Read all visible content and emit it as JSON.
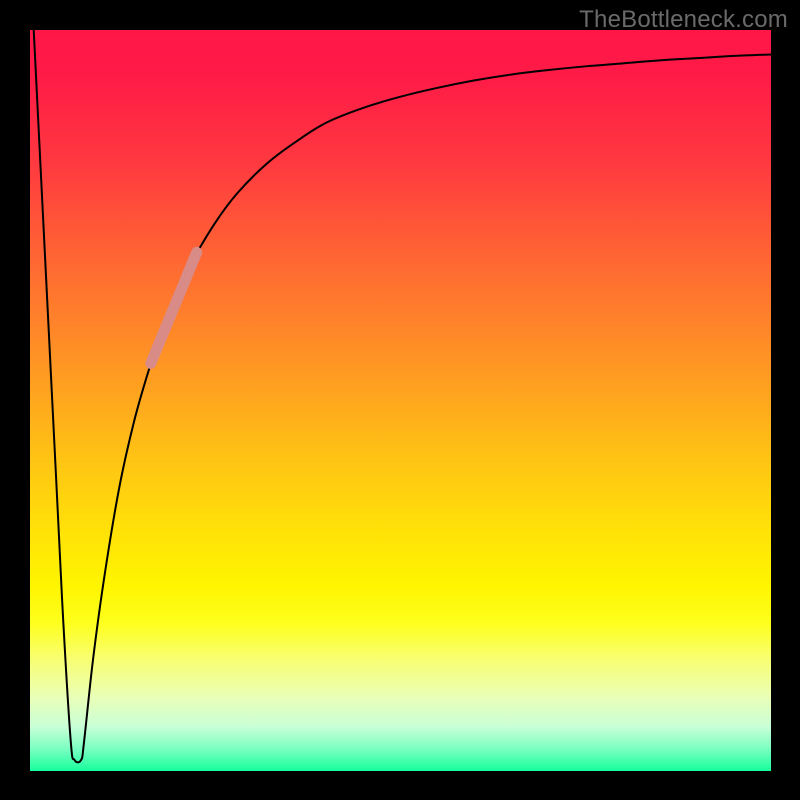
{
  "watermark": "TheBottleneck.com",
  "chart_data": {
    "type": "line",
    "title": "",
    "xlabel": "",
    "ylabel": "",
    "xlim": [
      0,
      100
    ],
    "ylim": [
      0,
      100
    ],
    "background_gradient_stops": [
      {
        "pos": 0.0,
        "color": "#ff1748"
      },
      {
        "pos": 0.06,
        "color": "#ff1a47"
      },
      {
        "pos": 0.18,
        "color": "#ff3940"
      },
      {
        "pos": 0.32,
        "color": "#ff6a32"
      },
      {
        "pos": 0.46,
        "color": "#ff9922"
      },
      {
        "pos": 0.58,
        "color": "#ffc414"
      },
      {
        "pos": 0.68,
        "color": "#ffe307"
      },
      {
        "pos": 0.75,
        "color": "#fff500"
      },
      {
        "pos": 0.8,
        "color": "#feff1d"
      },
      {
        "pos": 0.85,
        "color": "#f8ff73"
      },
      {
        "pos": 0.9,
        "color": "#eaffb7"
      },
      {
        "pos": 0.94,
        "color": "#c9ffd6"
      },
      {
        "pos": 0.97,
        "color": "#7bffc2"
      },
      {
        "pos": 1.0,
        "color": "#17ff9d"
      }
    ],
    "series": [
      {
        "name": "bottleneck-curve",
        "stroke": "#000000",
        "stroke_width": 2,
        "points": [
          {
            "x": 0.5,
            "y": 100.0
          },
          {
            "x": 1.5,
            "y": 80.0
          },
          {
            "x": 2.5,
            "y": 60.0
          },
          {
            "x": 3.5,
            "y": 40.0
          },
          {
            "x": 4.5,
            "y": 20.0
          },
          {
            "x": 5.5,
            "y": 4.0
          },
          {
            "x": 6.0,
            "y": 1.5
          },
          {
            "x": 6.9,
            "y": 1.5
          },
          {
            "x": 7.3,
            "y": 4.0
          },
          {
            "x": 8.5,
            "y": 15.0
          },
          {
            "x": 10.0,
            "y": 26.0
          },
          {
            "x": 12.0,
            "y": 38.0
          },
          {
            "x": 14.0,
            "y": 47.0
          },
          {
            "x": 16.0,
            "y": 54.0
          },
          {
            "x": 18.0,
            "y": 60.0
          },
          {
            "x": 20.0,
            "y": 65.0
          },
          {
            "x": 22.0,
            "y": 69.0
          },
          {
            "x": 25.0,
            "y": 74.0
          },
          {
            "x": 28.0,
            "y": 78.0
          },
          {
            "x": 32.0,
            "y": 82.0
          },
          {
            "x": 36.0,
            "y": 85.0
          },
          {
            "x": 40.0,
            "y": 87.5
          },
          {
            "x": 45.0,
            "y": 89.5
          },
          {
            "x": 50.0,
            "y": 91.0
          },
          {
            "x": 55.0,
            "y": 92.2
          },
          {
            "x": 60.0,
            "y": 93.2
          },
          {
            "x": 65.0,
            "y": 94.0
          },
          {
            "x": 70.0,
            "y": 94.6
          },
          {
            "x": 75.0,
            "y": 95.1
          },
          {
            "x": 80.0,
            "y": 95.5
          },
          {
            "x": 85.0,
            "y": 95.9
          },
          {
            "x": 90.0,
            "y": 96.2
          },
          {
            "x": 95.0,
            "y": 96.5
          },
          {
            "x": 100.0,
            "y": 96.7
          }
        ]
      },
      {
        "name": "highlight-segment",
        "stroke": "#d98b88",
        "stroke_width": 11,
        "linecap": "round",
        "points": [
          {
            "x": 16.3,
            "y": 55.0
          },
          {
            "x": 22.5,
            "y": 70.0
          }
        ]
      }
    ]
  }
}
